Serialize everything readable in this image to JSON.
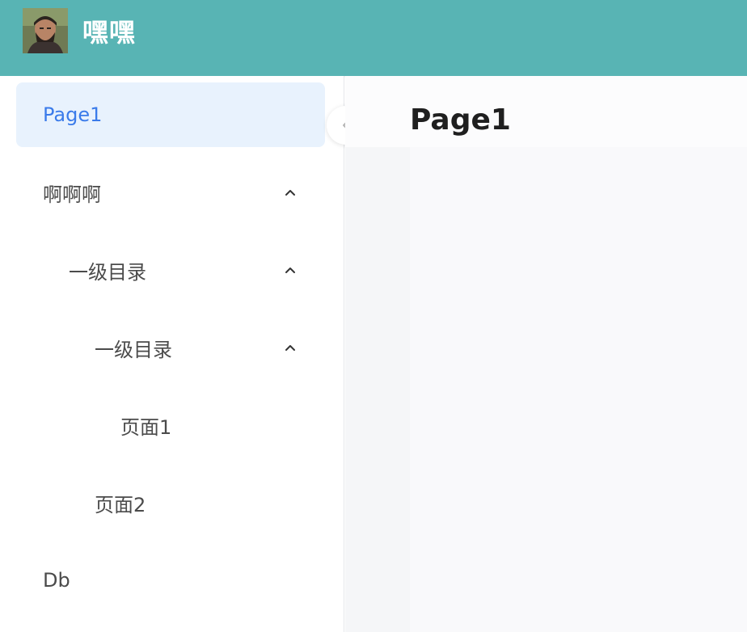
{
  "header": {
    "avatar": "user-avatar",
    "title": "嘿嘿",
    "background_color": "#58b4b4"
  },
  "sidebar": {
    "items": [
      {
        "label": "Page1",
        "active": true,
        "expandable": false
      },
      {
        "label": "啊啊啊",
        "active": false,
        "expandable": true,
        "expanded": true
      },
      {
        "label": "一级目录",
        "active": false,
        "expandable": true,
        "expanded": true
      },
      {
        "label": "一级目录",
        "active": false,
        "expandable": true,
        "expanded": true
      },
      {
        "label": "页面1",
        "active": false,
        "expandable": false
      },
      {
        "label": "页面2",
        "active": false,
        "expandable": false
      },
      {
        "label": "Db",
        "active": false,
        "expandable": false
      }
    ],
    "active_color": "#3a7bea",
    "active_background": "#e8f2fd"
  },
  "collapse_button": {
    "icon": "chevron-left-icon"
  },
  "main": {
    "page_title": "Page1"
  }
}
